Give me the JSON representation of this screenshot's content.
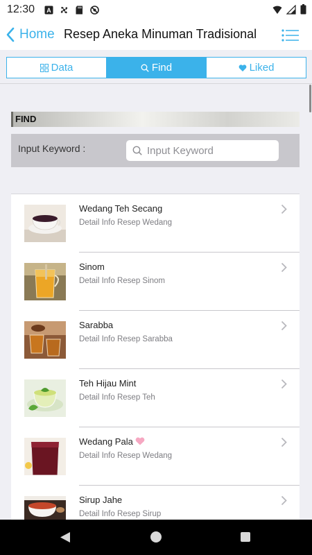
{
  "status_bar": {
    "time": "12:30",
    "icons_left": [
      "a-notification-icon",
      "fan-icon",
      "sd-card-icon",
      "no-tracking-icon"
    ],
    "icons_right": [
      "wifi-icon",
      "signal-icon",
      "battery-icon"
    ]
  },
  "navbar": {
    "back_label": "Home",
    "title": "Resep Aneka Minuman Tradisional",
    "menu_icon": "list-menu-icon"
  },
  "tabs": [
    {
      "label": "Data",
      "icon": "grid-icon",
      "active": false
    },
    {
      "label": "Find",
      "icon": "search-icon",
      "active": true
    },
    {
      "label": "Liked",
      "icon": "heart-icon",
      "active": false
    }
  ],
  "find": {
    "header": "FIND",
    "keyword_label": "Input Keyword :",
    "input_placeholder": "Input Keyword",
    "input_value": ""
  },
  "recipes": [
    {
      "title": "Wedang Teh Secang",
      "subtitle": "Detail Info Resep Wedang",
      "liked": false
    },
    {
      "title": "Sinom",
      "subtitle": "Detail Info Resep Sinom",
      "liked": false
    },
    {
      "title": "Sarabba",
      "subtitle": "Detail Info Resep Sarabba",
      "liked": false
    },
    {
      "title": "Teh Hijau Mint",
      "subtitle": "Detail Info Resep Teh",
      "liked": false
    },
    {
      "title": "Wedang Pala",
      "subtitle": "Detail Info Resep Wedang",
      "liked": true
    },
    {
      "title": "Sirup Jahe",
      "subtitle": "Detail Info Resep Sirup",
      "liked": false
    }
  ],
  "colors": {
    "accent": "#3bb2ea",
    "heart": "#f6a8c2"
  },
  "android_nav": [
    "back-triangle-icon",
    "home-circle-icon",
    "recents-square-icon"
  ]
}
